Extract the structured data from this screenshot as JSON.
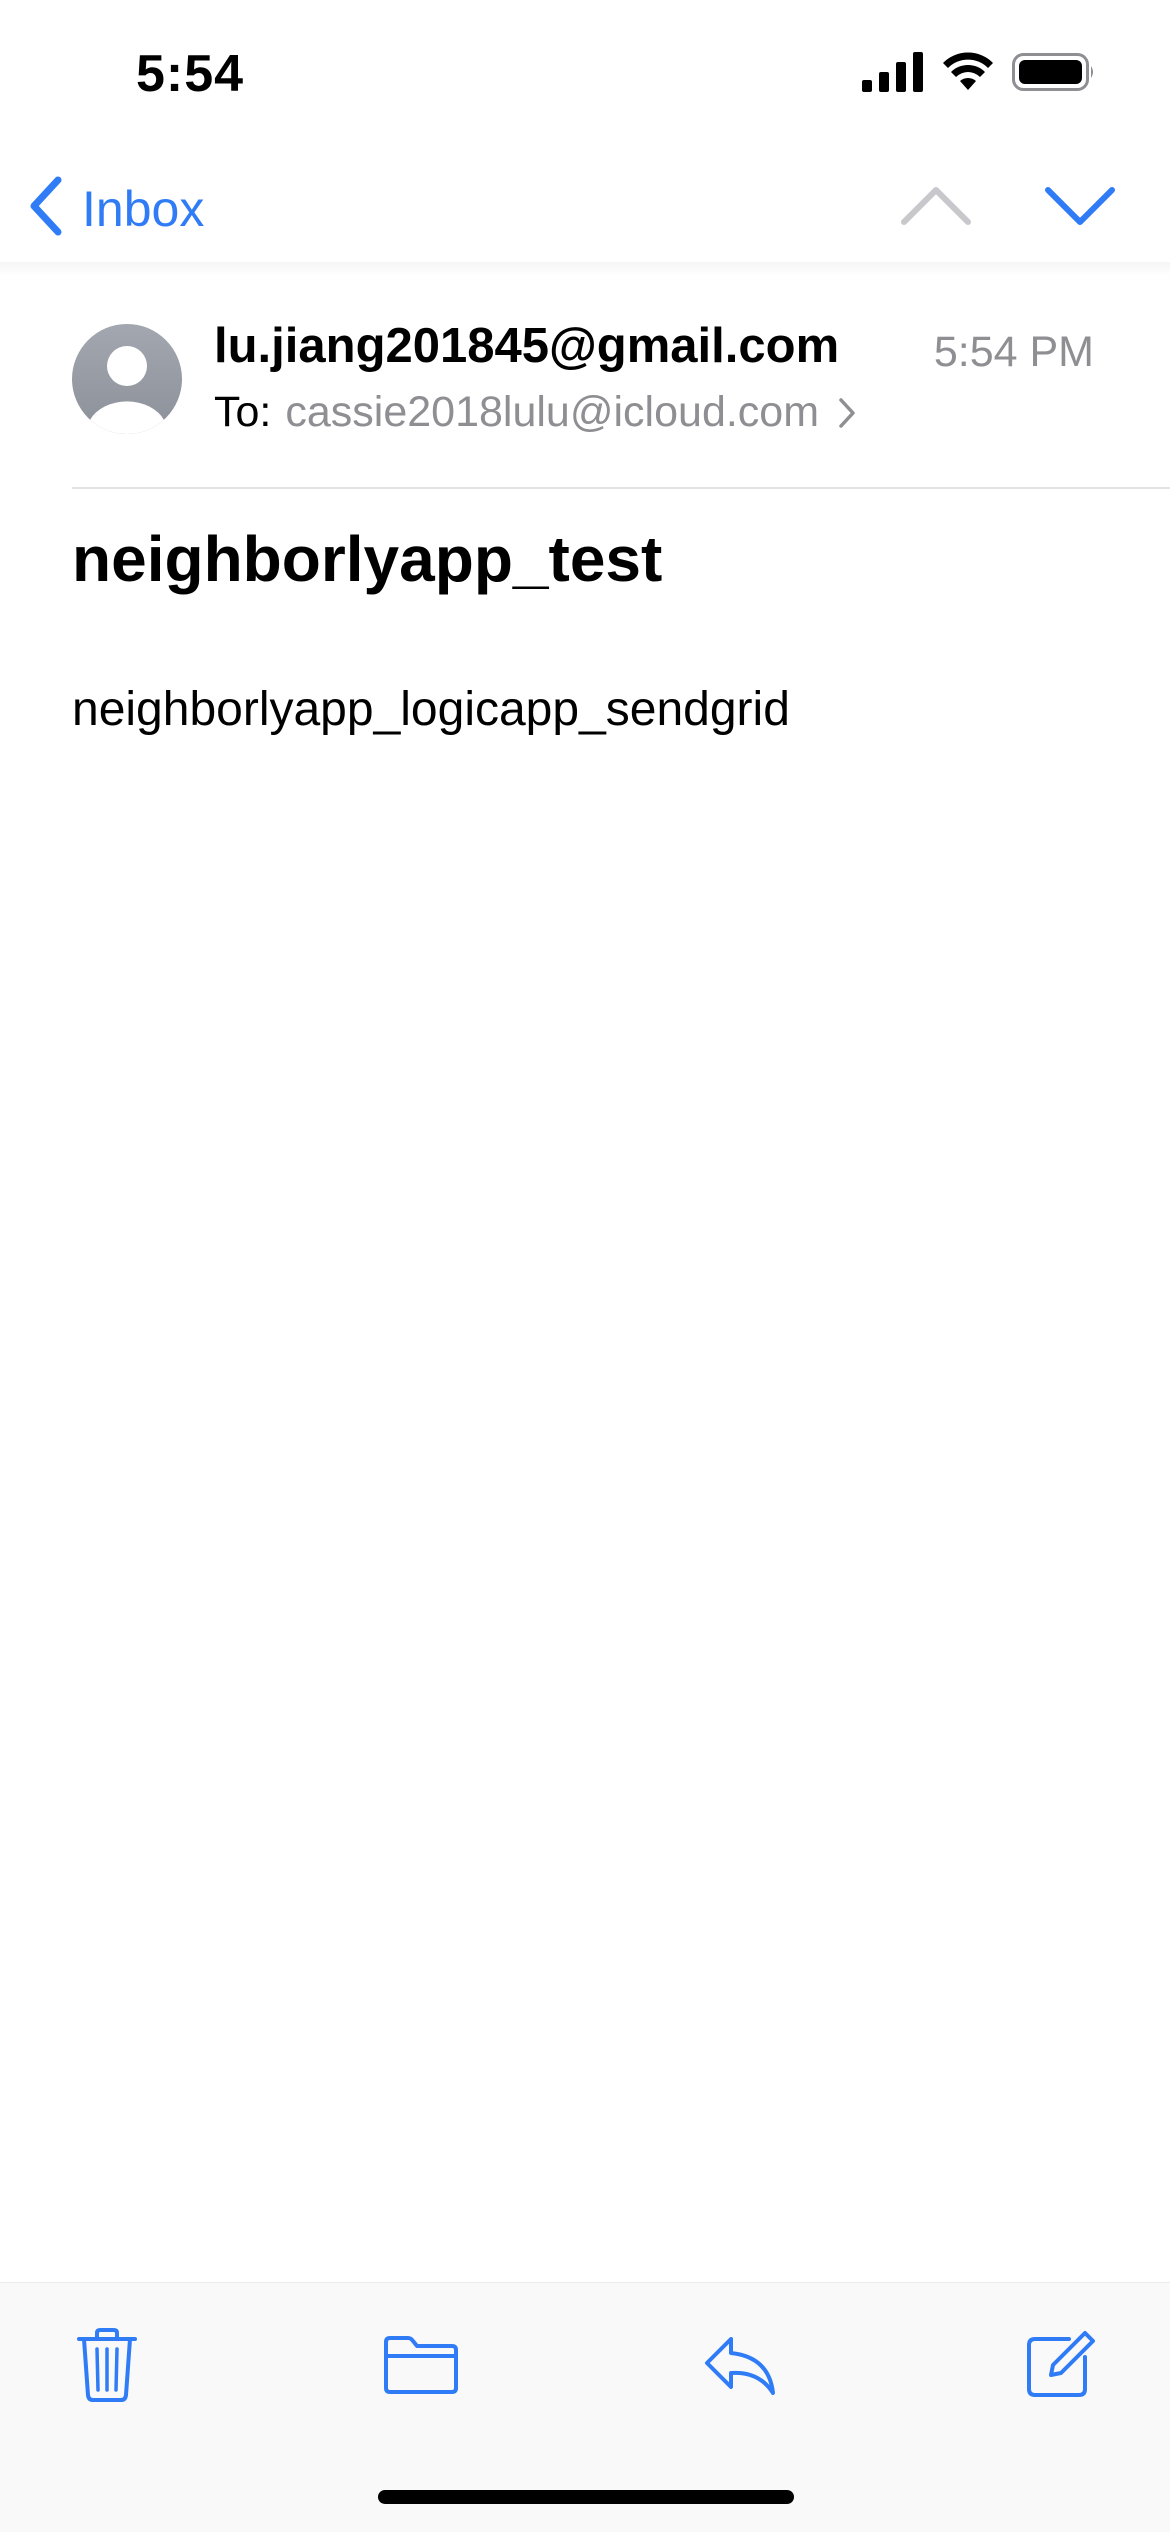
{
  "status_bar": {
    "time": "5:54",
    "icons": [
      "cellular-signal-icon",
      "wifi-icon",
      "battery-icon"
    ]
  },
  "nav": {
    "back_label": "Inbox",
    "prev_icon": "chevron-up-icon",
    "next_icon": "chevron-down-icon",
    "accent_color": "#2f7cf6",
    "disabled_color": "#c7c7cc"
  },
  "message": {
    "sender": "lu.jiang201845@gmail.com",
    "time": "5:54 PM",
    "to_label": "To:",
    "to_address": "cassie2018lulu@icloud.com",
    "subject": "neighborlyapp_test",
    "body": "neighborlyapp_logicapp_sendgrid"
  },
  "toolbar": {
    "items": [
      "trash-icon",
      "folder-icon",
      "reply-icon",
      "compose-icon"
    ]
  }
}
